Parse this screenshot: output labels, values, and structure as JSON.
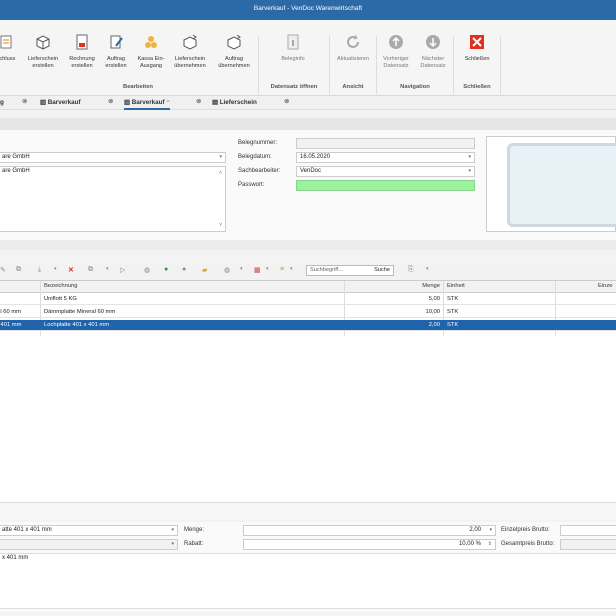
{
  "title": "Barverkauf - VenDoc Warenwirtschaft",
  "ribbon": {
    "buttons": [
      {
        "label1": "schluss",
        "label2": "",
        "icon": "close-document-icon"
      },
      {
        "label1": "Lieferschein",
        "label2": "erstellen",
        "icon": "delivery-icon"
      },
      {
        "label1": "Rechnung",
        "label2": "erstellen",
        "icon": "invoice-icon"
      },
      {
        "label1": "Auftrag",
        "label2": "erstellen",
        "icon": "order-icon"
      },
      {
        "label1": "Kassa Ein-",
        "label2": "Ausgang",
        "icon": "cash-icon"
      },
      {
        "label1": "Lieferschein",
        "label2": "übernehmen",
        "icon": "delivery-import-icon"
      },
      {
        "label1": "Auftrag",
        "label2": "übernehmen",
        "icon": "order-import-icon"
      },
      {
        "label1": "Beleginfo",
        "label2": "",
        "icon": "info-icon"
      },
      {
        "label1": "Aktualisieren",
        "label2": "",
        "icon": "refresh-icon"
      },
      {
        "label1": "Vorheriger",
        "label2": "Datensatz",
        "icon": "up-arrow-icon"
      },
      {
        "label1": "Nächster",
        "label2": "Datensatz",
        "icon": "down-arrow-icon"
      },
      {
        "label1": "Schließen",
        "label2": "",
        "icon": "close-icon"
      }
    ],
    "groups": [
      "Bearbeiten",
      "Datensatz öffnen",
      "Ansicht",
      "Navigation",
      "Schließen"
    ]
  },
  "tabs": [
    "g",
    "Barverkauf",
    "Barverkauf",
    "Lieferschein"
  ],
  "form": {
    "customer": "are GmbH",
    "address": "are GmbH",
    "belegnummer_label": "Belegnummer:",
    "belegnummer": "",
    "belegdatum_label": "Belegdatum:",
    "belegdatum": "16.05.2020",
    "sachbearbeiter_label": "Sachbearbeiter:",
    "sachbearbeiter": "VenDoc",
    "passwort_label": "Passwort:",
    "passwort": ""
  },
  "search": {
    "placeholder": "Suchbegriff...",
    "button": "Suche"
  },
  "grid": {
    "headers": [
      "Bezeichnung",
      "Menge",
      "Einheit",
      "Einze"
    ],
    "rows": [
      {
        "c0": "",
        "bez": "Uniflott 5 KG",
        "menge": "5,00",
        "einheit": "STK",
        "selected": false
      },
      {
        "c0": "eral 60 mm",
        "bez": "Dämmplatte Mineral 60 mm",
        "menge": "10,00",
        "einheit": "STK",
        "selected": false
      },
      {
        "c0": "x 401 mm",
        "bez": "Lochplatte 401 x 401 mm",
        "menge": "2,00",
        "einheit": "STK",
        "selected": true
      }
    ]
  },
  "detail": {
    "article": "atte 401 x 401 mm",
    "menge_label": "Menge:",
    "menge": "2,00",
    "rabatt_label": "Rabatt:",
    "rabatt": "10,00 %",
    "ep_brutto_label": "Einzelpreis Brutto:",
    "gp_brutto_label": "Gesamtpreis Brutto:",
    "note": "x 401 mm"
  }
}
